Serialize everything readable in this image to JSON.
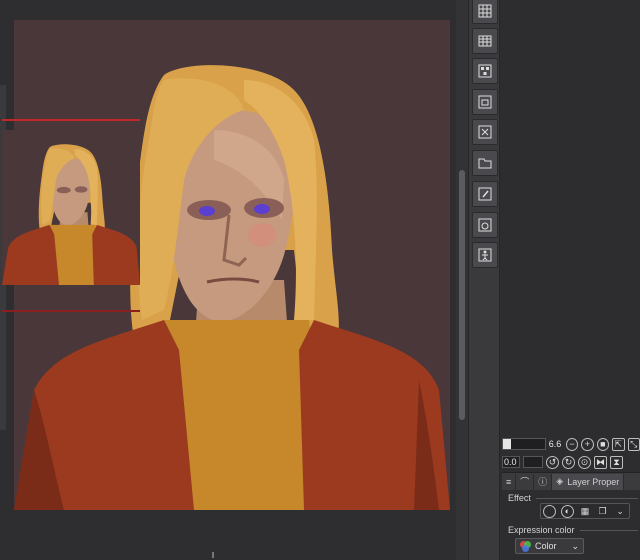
{
  "canvas": {
    "background_color": "#4a3739"
  },
  "command_bar": {
    "buttons": [
      {
        "icon": "grid-layout-icon"
      },
      {
        "icon": "grid-table-icon"
      },
      {
        "icon": "checker-pattern-icon"
      },
      {
        "icon": "frame-window-icon"
      },
      {
        "icon": "shrink-window-icon"
      },
      {
        "icon": "folder-window-icon"
      },
      {
        "icon": "edit-window-icon"
      },
      {
        "icon": "camera-window-icon"
      },
      {
        "icon": "figure-window-icon"
      }
    ]
  },
  "navigator": {
    "accent_color": "#c0262a"
  },
  "controls": {
    "zoom_value": "6.6",
    "zoom_fill_fraction": 0.18,
    "rotate_value": "0.0"
  },
  "tabs": {
    "menu_icon": "≡",
    "layer_properties_label": "Layer Proper"
  },
  "layer_property": {
    "effect_label": "Effect",
    "expression_color_label": "Expression color",
    "expression_color_value": "Color"
  }
}
